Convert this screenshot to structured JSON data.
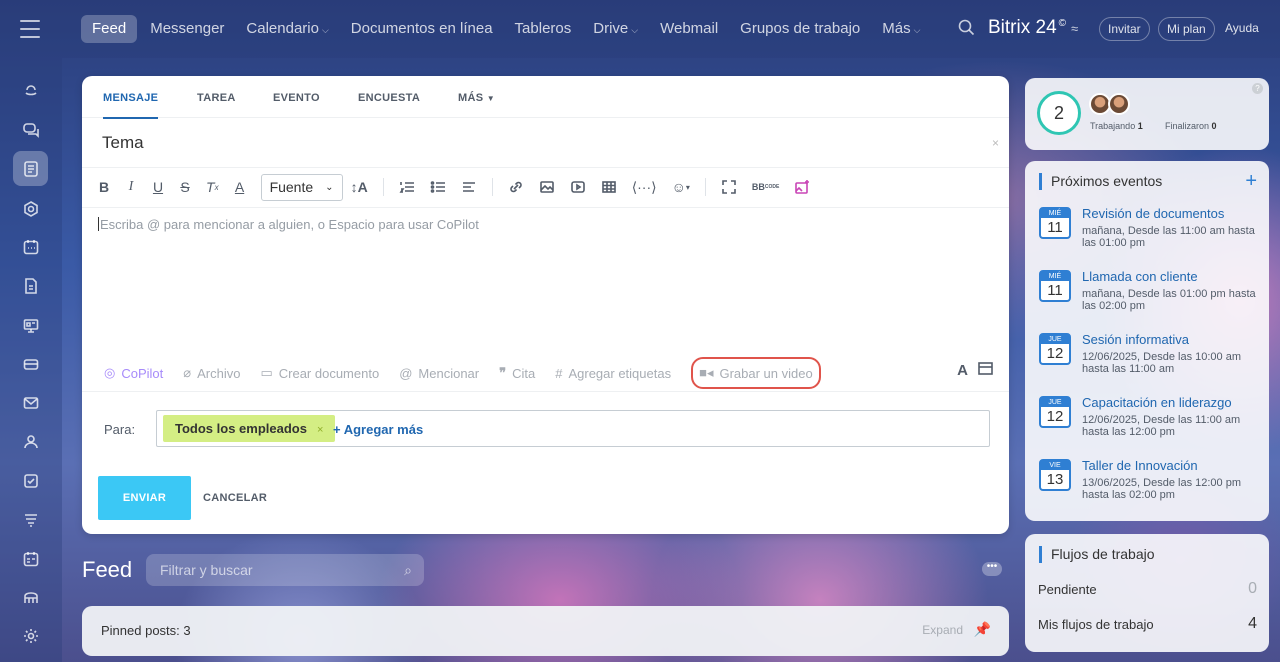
{
  "topnav": {
    "items": [
      {
        "label": "Feed",
        "active": true,
        "chevron": false
      },
      {
        "label": "Messenger",
        "chevron": false
      },
      {
        "label": "Calendario",
        "chevron": true
      },
      {
        "label": "Documentos en línea",
        "chevron": false
      },
      {
        "label": "Tableros",
        "chevron": false
      },
      {
        "label": "Drive",
        "chevron": true
      },
      {
        "label": "Webmail",
        "chevron": false
      },
      {
        "label": "Grupos de trabajo",
        "chevron": false
      },
      {
        "label": "Más",
        "chevron": true
      }
    ],
    "brand": "Bitrix 24",
    "brand_sup": "©",
    "invite": "Invitar",
    "plan": "Mi plan",
    "help": "Ayuda"
  },
  "sidebar": {
    "icons": [
      "copilot-icon",
      "chat-icon",
      "feed-icon",
      "collab-icon",
      "calendar-icon",
      "documents-icon",
      "boards-icon",
      "drive-icon",
      "mail-icon",
      "groups-icon",
      "tasks-icon",
      "crm-icon",
      "planner-icon",
      "company-icon",
      "settings-icon"
    ]
  },
  "composer": {
    "tabs": [
      "MENSAJE",
      "TAREA",
      "EVENTO",
      "ENCUESTA",
      "MÁS"
    ],
    "topic": "Tema",
    "font_label": "Fuente",
    "placeholder": "Escriba @ para mencionar a alguien, o Espacio para usar CoPilot",
    "actions": {
      "copilot": "CoPilot",
      "file": "Archivo",
      "create_doc": "Crear documento",
      "mention": "Mencionar",
      "quote": "Cita",
      "tags": "Agregar etiquetas",
      "video": "Grabar un video"
    },
    "to_label": "Para:",
    "recipient": "Todos los empleados",
    "add_more": "+ Agregar más",
    "send": "ENVIAR",
    "cancel": "CANCELAR"
  },
  "feed": {
    "title": "Feed",
    "search_placeholder": "Filtrar y buscar",
    "pinned": "Pinned posts: 3",
    "expand": "Expand"
  },
  "status": {
    "count": "2",
    "working_label": "Trabajando",
    "working": "1",
    "finished_label": "Finalizaron",
    "finished": "0"
  },
  "events": {
    "title": "Próximos eventos",
    "items": [
      {
        "dow": "MIÉ",
        "day": "11",
        "title": "Revisión de documentos",
        "when": "mañana, Desde las 11:00 am hasta las 01:00 pm"
      },
      {
        "dow": "MIÉ",
        "day": "11",
        "title": "Llamada con cliente",
        "when": "mañana, Desde las 01:00 pm hasta las 02:00 pm"
      },
      {
        "dow": "JUE",
        "day": "12",
        "title": "Sesión informativa",
        "when": "12/06/2025, Desde las 10:00 am hasta las 11:00 am"
      },
      {
        "dow": "JUE",
        "day": "12",
        "title": "Capacitación en liderazgo",
        "when": "12/06/2025, Desde las 11:00 am hasta las 12:00 pm"
      },
      {
        "dow": "VIE",
        "day": "13",
        "title": "Taller de Innovación",
        "when": "13/06/2025, Desde las 12:00 pm hasta las 02:00 pm"
      }
    ]
  },
  "flows": {
    "title": "Flujos de trabajo",
    "pending_label": "Pendiente",
    "pending": "0",
    "mine_label": "Mis flujos de trabajo",
    "mine": "4"
  },
  "colors": {
    "accent": "#2067b0",
    "send": "#3bc8f5",
    "tag": "#d4ee84",
    "highlight": "#e0544b"
  }
}
